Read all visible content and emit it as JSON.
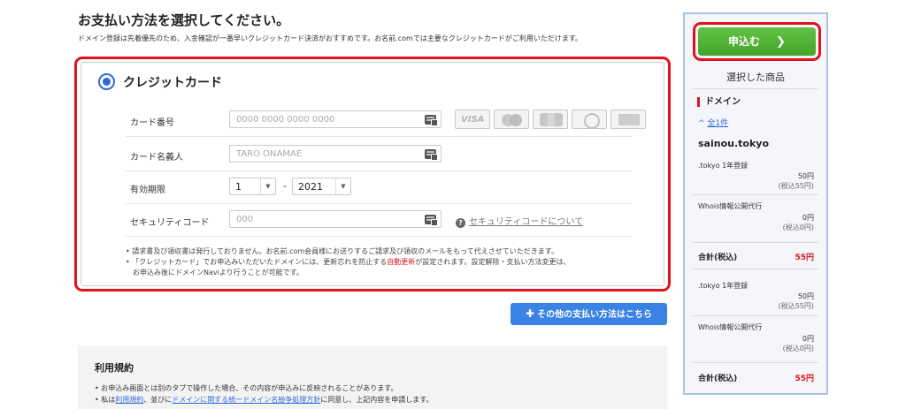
{
  "header": {
    "title": "お支払い方法を選択してください。",
    "subtitle": "ドメイン登録は先着優先のため、入金確認が一番早いクレジットカード決済がおすすめです。お名前.comでは主要なクレジットカードがご利用いただけます。"
  },
  "credit_card": {
    "title": "クレジットカード",
    "number_label": "カード番号",
    "number_placeholder": "0000 0000 0000 0000",
    "holder_label": "カード名義人",
    "holder_placeholder": "TARO ONAMAE",
    "expiry_label": "有効期限",
    "expiry_month": "1",
    "expiry_year": "2021",
    "expiry_separator": "-",
    "security_label": "セキュリティコード",
    "security_placeholder": "000",
    "security_help_link": "セキュリティコードについて",
    "card_brands": [
      "VISA",
      "MasterCard",
      "JCB",
      "Diners",
      "AMEX"
    ],
    "notes": {
      "line1": "• 請求書及び領収書は発行しておりません。お名前.com会員様にお送りするご請求及び領収のメールをもって代えさせていただきます。",
      "line2_a": "• 「クレジットカード」でお申込みいただいたドメインには、更新忘れを防止する",
      "line2_red": "自動更新",
      "line2_b": "が設定されます。設定解除・支払い方法変更は、",
      "line3": "お申込み後にドメインNaviより行うことが可能です。"
    }
  },
  "other_payment_button": "その他の支払い方法はこちら",
  "terms": {
    "title": "利用規約",
    "line1": "• お申込み画面とは別のタブで操作した場合、その内容が申込みに反映されることがあります。",
    "line2_a": "• 私は",
    "line2_link1": "利用規約",
    "line2_b": "、並びに",
    "line2_link2": "ドメインに関する統一ドメイン名紛争処理方針",
    "line2_c": "に同意し、上記内容を申請します。"
  },
  "sidebar": {
    "apply_button": "申込む",
    "selected_title": "選択した商品",
    "section_label": "ドメイン",
    "toggle_label": "全1件",
    "domain_name": "sainou.tokyo",
    "item1_name": ".tokyo 1年登録",
    "item1_price": "50円",
    "item1_tax": "(税込55円)",
    "item2_name": "Whois情報公開代行",
    "item2_price": "0円",
    "item2_tax": "(税込0円)",
    "total_label": "合計(税込)",
    "total_value": "55円",
    "item3_name": ".tokyo 1年登録",
    "item3_price": "50円",
    "item3_tax": "(税込55円)",
    "item4_name": "Whois情報公開代行",
    "item4_price": "0円",
    "item4_tax": "(税込0円)",
    "total2_label": "合計(税込)",
    "total2_value": "55円"
  },
  "colors": {
    "highlight_red": "#e0121b",
    "primary_blue": "#3b82e5",
    "apply_green": "#45a52a",
    "link_blue": "#2f6bd8"
  }
}
